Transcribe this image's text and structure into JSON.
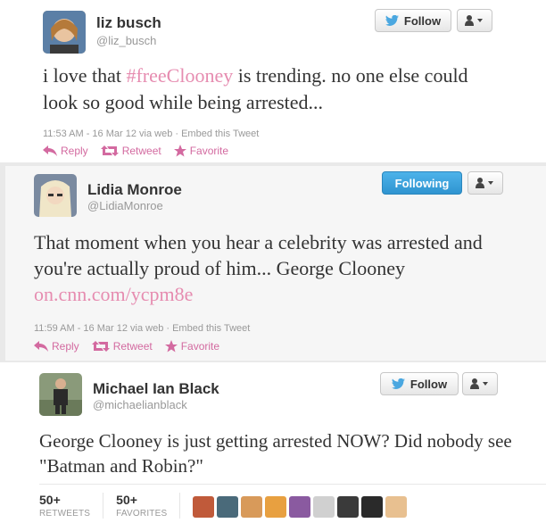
{
  "tweets": [
    {
      "name": "liz busch",
      "handle": "@liz_busch",
      "button": "Follow",
      "text_before": "i love that ",
      "hashtag": "#freeClooney",
      "text_after": " is trending. no one else could look so good while being arrested...",
      "meta": "11:53 AM - 16 Mar 12 via web · Embed this Tweet",
      "reply": "Reply",
      "retweet": "Retweet",
      "favorite": "Favorite"
    },
    {
      "name": "Lidia Monroe",
      "handle": "@LidiaMonroe",
      "button": "Following",
      "text": "That moment when you hear a celebrity was arrested and you're actually proud of him... George Clooney ",
      "link": "on.cnn.com/ycpm8e",
      "meta": "11:59 AM - 16 Mar 12 via web · Embed this Tweet",
      "reply": "Reply",
      "retweet": "Retweet",
      "favorite": "Favorite"
    },
    {
      "name": "Michael Ian Black",
      "handle": "@michaelianblack",
      "button": "Follow",
      "text": "George Clooney is just getting arrested NOW? Did nobody see \"Batman and Robin?\"",
      "retweets_count": "50+",
      "retweets_label": "RETWEETS",
      "favorites_count": "50+",
      "favorites_label": "FAVORITES"
    }
  ],
  "colors": {
    "accent_pink": "#d36aa0",
    "hashtag_pink": "#e68cb0",
    "following_blue": "#2f94d0",
    "bird_blue": "#4aa7e0"
  },
  "icons": [
    "twitter-bird-icon",
    "user-dropdown-icon",
    "reply-icon",
    "retweet-icon",
    "favorite-star-icon"
  ]
}
